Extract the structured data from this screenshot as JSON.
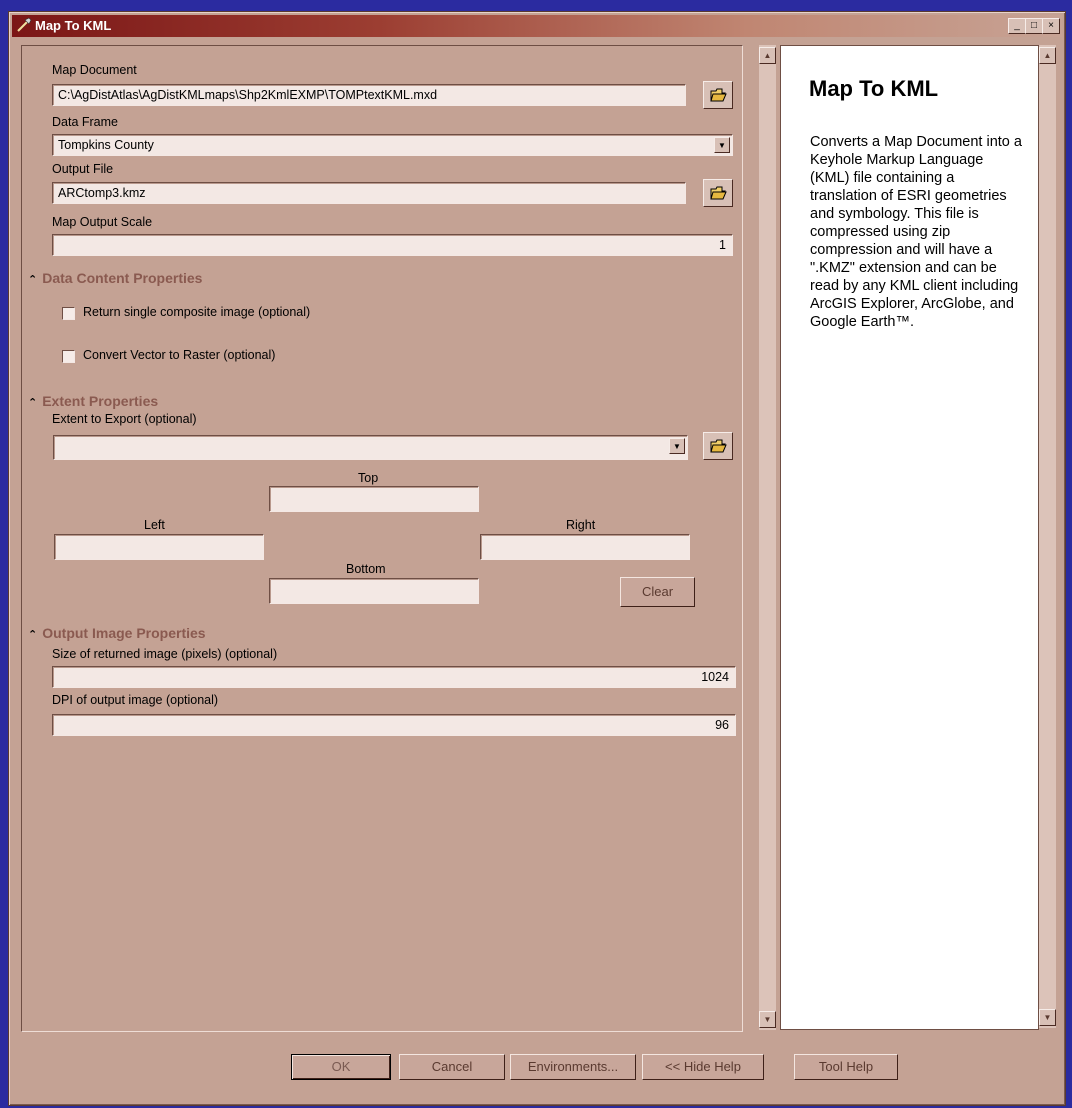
{
  "window": {
    "title": "Map To KML",
    "controls": {
      "minimize": "_",
      "maximize": "□",
      "close": "×"
    }
  },
  "form": {
    "map_document": {
      "label": "Map Document",
      "value": "C:\\AgDistAtlas\\AgDistKMLmaps\\Shp2KmlEXMP\\TOMPtextKML.mxd"
    },
    "data_frame": {
      "label": "Data Frame",
      "value": "Tompkins County"
    },
    "output_file": {
      "label": "Output File",
      "value": "ARCtomp3.kmz"
    },
    "map_output_scale": {
      "label": "Map Output Scale",
      "value": "1"
    },
    "data_content": {
      "heading": "Data Content Properties",
      "return_composite": {
        "label": "Return single composite image (optional)",
        "checked": false
      },
      "vector_to_raster": {
        "label": "Convert Vector to Raster (optional)",
        "checked": false
      }
    },
    "extent": {
      "heading": "Extent Properties",
      "label": "Extent to Export (optional)",
      "value": "",
      "top": "Top",
      "left": "Left",
      "right": "Right",
      "bottom": "Bottom",
      "clear": "Clear"
    },
    "output_image": {
      "heading": "Output Image Properties",
      "size": {
        "label": "Size of returned image (pixels) (optional)",
        "value": "1024"
      },
      "dpi": {
        "label": "DPI of output image (optional)",
        "value": "96"
      }
    }
  },
  "help": {
    "title": "Map To KML",
    "body": "Converts a Map Document into a Keyhole Markup Language (KML) file containing a translation of ESRI geometries and symbology. This file is compressed using zip compression and will have a \".KMZ\" extension and can be read by any KML client including ArcGIS Explorer, ArcGlobe, and Google Earth™."
  },
  "buttons": {
    "ok": "OK",
    "cancel": "Cancel",
    "environments": "Environments...",
    "hide_help": "<< Hide Help",
    "tool_help": "Tool Help"
  },
  "colors": {
    "desktop": "#2b2ba0",
    "dialog": "#c4a294",
    "section_heading": "#8a5a50",
    "titlebar_start": "#7b1616"
  },
  "icons": {
    "window": "hammer-icon",
    "browse": "open-folder-icon",
    "collapse": "chevron-double-up-icon",
    "dropdown": "chevron-down-icon",
    "scroll_up": "scroll-up-arrow-icon",
    "scroll_down": "scroll-down-arrow-icon"
  }
}
